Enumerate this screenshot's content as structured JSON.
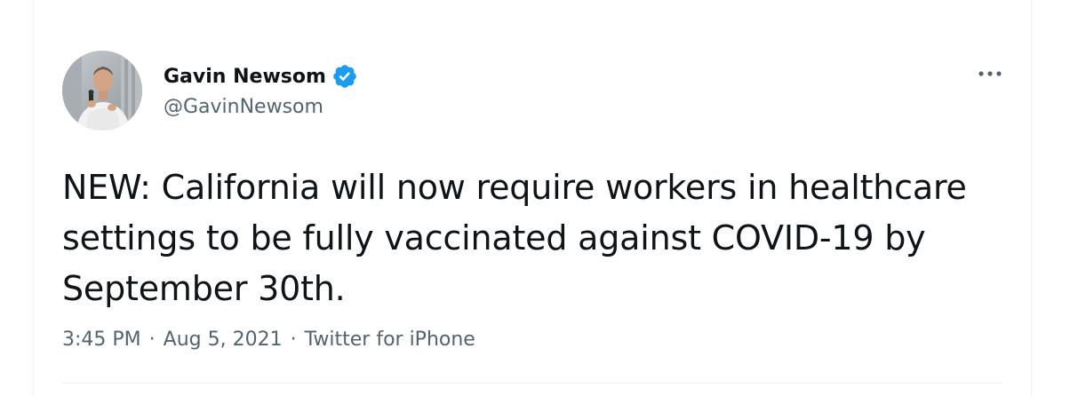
{
  "author": {
    "name": "Gavin Newsom",
    "handle": "@GavinNewsom",
    "verified": true,
    "avatar_icon": "profile-photo"
  },
  "tweet": {
    "text": "NEW: California will now require workers in healthcare settings to be fully vaccinated against COVID-19 by September 30th.",
    "time": "3:45 PM",
    "date": "Aug 5, 2021",
    "source": "Twitter for iPhone",
    "separator": "·"
  },
  "menu": {
    "icon": "more-options-icon"
  },
  "colors": {
    "text_primary": "#0f1419",
    "text_secondary": "#536471",
    "verified_blue": "#1d9bf0",
    "divider": "#eff3f4"
  }
}
